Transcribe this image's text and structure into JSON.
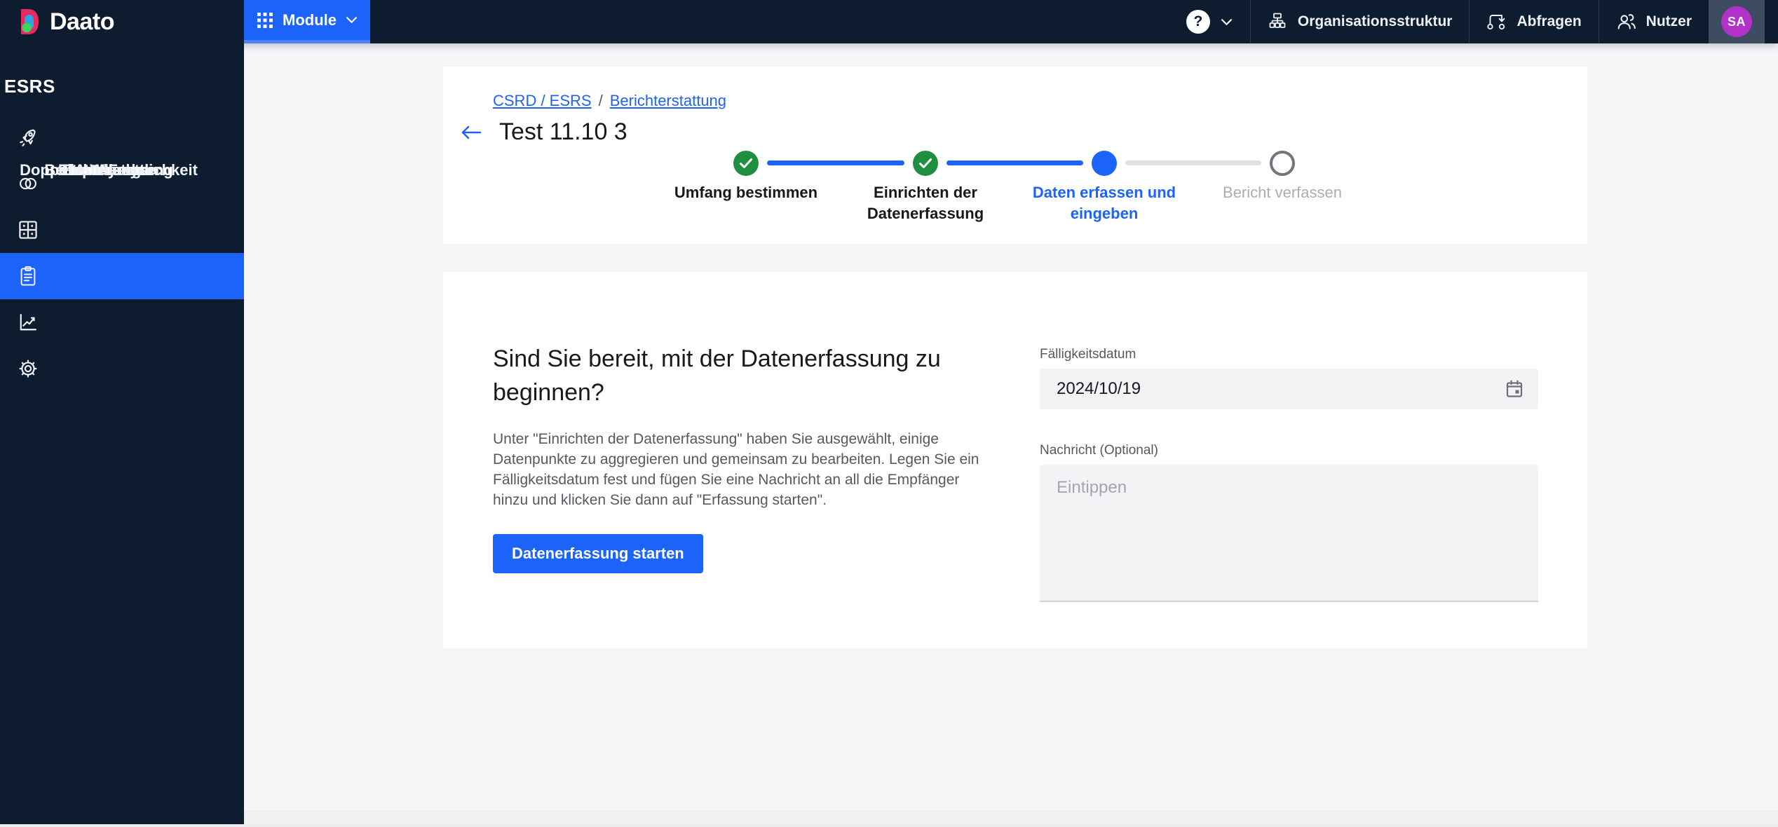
{
  "colors": {
    "accent_blue": "#1c63f9",
    "success_green": "#1f8f3f",
    "navy": "#0e1c2f",
    "avatar_purple": "#b231c9",
    "content_bg": "#f5f6f8"
  },
  "navbar": {
    "logo_text": "Daato",
    "module_label": "Module",
    "help_glyph": "?",
    "items": [
      {
        "label": "Organisationsstruktur",
        "icon": "org-chart-icon"
      },
      {
        "label": "Abfragen",
        "icon": "flow-icon"
      },
      {
        "label": "Nutzer",
        "icon": "users-icon"
      }
    ],
    "avatar_initials": "SA"
  },
  "sidebar": {
    "section_title": "ESRS",
    "items": [
      {
        "label": "Roter Faden",
        "icon": "rocket-icon",
        "active": false
      },
      {
        "label": "Doppelte Wesentlichkeit",
        "icon": "venn-icon",
        "active": false
      },
      {
        "label": "Gap-Analyse",
        "icon": "quadrant-icon",
        "active": false
      },
      {
        "label": "Berichterstattung",
        "icon": "clipboard-icon",
        "active": true
      },
      {
        "label": "Analysen",
        "icon": "line-chart-icon",
        "active": false
      },
      {
        "label": "Einstellungen",
        "icon": "gear-icon",
        "active": false
      }
    ]
  },
  "header": {
    "breadcrumb": {
      "links": [
        "CSRD / ESRS",
        "Berichterstattung"
      ],
      "separator": "/"
    },
    "title": "Test 11.10 3"
  },
  "stepper": {
    "steps": [
      {
        "label": "Umfang bestimmen",
        "state": "done"
      },
      {
        "label": "Einrichten der Datenerfassung",
        "state": "done"
      },
      {
        "label": "Daten erfassen und eingeben",
        "state": "current"
      },
      {
        "label": "Bericht verfassen",
        "state": "upcoming"
      }
    ]
  },
  "content": {
    "heading": "Sind Sie bereit, mit der Datenerfassung zu beginnen?",
    "body": "Unter \"Einrichten der Datenerfassung\" haben Sie ausgewählt, einige Datenpunkte zu aggregieren und gemeinsam zu bearbeiten. Legen Sie ein Fälligkeitsdatum fest und fügen Sie eine Nachricht an all die Empfänger hinzu und klicken Sie dann auf \"Erfassung starten\".",
    "start_button": "Datenerfassung starten",
    "form": {
      "due_date_label": "Fälligkeitsdatum",
      "due_date_value": "2024/10/19",
      "message_label": "Nachricht (Optional)",
      "message_placeholder": "Eintippen"
    }
  }
}
